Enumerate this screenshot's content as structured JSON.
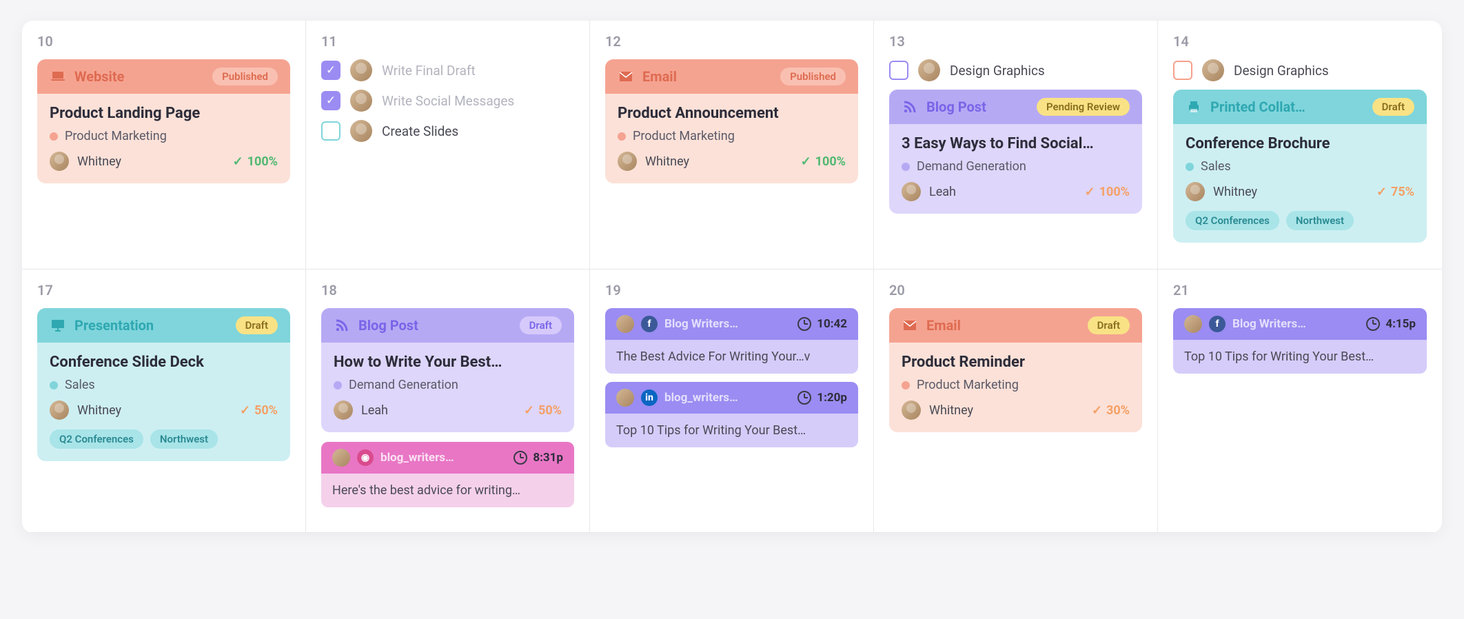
{
  "days": [
    {
      "number": "10",
      "tasks": [],
      "cards": [
        {
          "kind": "full",
          "theme": "theme-orange",
          "icon": "laptop",
          "type_label": "Website",
          "status": "Published",
          "status_class": "",
          "title": "Product Landing Page",
          "category": "Product Marketing",
          "dot_color": "#f5a391",
          "assignee": "Whitney",
          "progress": "100%",
          "progress_check": "green",
          "tags": []
        }
      ]
    },
    {
      "number": "11",
      "tasks": [
        {
          "checked": true,
          "cb": "checked",
          "label": "Write Final Draft",
          "done": true
        },
        {
          "checked": true,
          "cb": "checked",
          "label": "Write Social Messages",
          "done": true
        },
        {
          "checked": false,
          "cb": "unchecked-teal",
          "label": "Create Slides",
          "done": false
        }
      ],
      "cards": []
    },
    {
      "number": "12",
      "tasks": [],
      "cards": [
        {
          "kind": "full",
          "theme": "theme-orange",
          "icon": "envelope",
          "type_label": "Email",
          "status": "Published",
          "status_class": "",
          "title": "Product Announcement",
          "category": "Product Marketing",
          "dot_color": "#f5a391",
          "assignee": "Whitney",
          "progress": "100%",
          "progress_check": "green",
          "tags": []
        }
      ]
    },
    {
      "number": "13",
      "tasks": [
        {
          "checked": false,
          "cb": "unchecked",
          "label": "Design Graphics",
          "done": false
        }
      ],
      "cards": [
        {
          "kind": "full",
          "theme": "theme-purple",
          "icon": "rss",
          "type_label": "Blog Post",
          "status": "Pending Review",
          "status_class": "",
          "title": "3 Easy Ways to Find Social…",
          "category": "Demand Generation",
          "dot_color": "#b6a9f4",
          "assignee": "Leah",
          "progress": "100%",
          "progress_check": "orange",
          "tags": []
        }
      ]
    },
    {
      "number": "14",
      "tasks": [
        {
          "checked": false,
          "cb": "unchecked-orange",
          "label": "Design Graphics",
          "done": false
        }
      ],
      "cards": [
        {
          "kind": "full",
          "theme": "theme-cyan",
          "icon": "printer",
          "type_label": "Printed Collat…",
          "status": "Draft",
          "status_class": "",
          "title": "Conference Brochure",
          "category": "Sales",
          "dot_color": "#7fd5db",
          "assignee": "Whitney",
          "progress": "75%",
          "progress_check": "orange",
          "tags": [
            {
              "text": "Q2 Conferences",
              "class": "tag-cyan"
            },
            {
              "text": "Northwest",
              "class": "tag-cyan"
            }
          ]
        }
      ]
    },
    {
      "number": "17",
      "tasks": [],
      "cards": [
        {
          "kind": "full",
          "theme": "theme-cyan",
          "icon": "presentation",
          "type_label": "Presentation",
          "status": "Draft",
          "status_class": "",
          "title": "Conference Slide Deck",
          "category": "Sales",
          "dot_color": "#7fd5db",
          "assignee": "Whitney",
          "progress": "50%",
          "progress_check": "orange",
          "tags": [
            {
              "text": "Q2 Conferences",
              "class": "tag-cyan"
            },
            {
              "text": "Northwest",
              "class": "tag-cyan"
            }
          ]
        }
      ]
    },
    {
      "number": "18",
      "tasks": [],
      "cards": [
        {
          "kind": "full",
          "theme": "theme-purple",
          "icon": "rss",
          "type_label": "Blog Post",
          "status": "Draft",
          "status_class": "draft",
          "title": "How to Write Your Best…",
          "category": "Demand Generation",
          "dot_color": "#b6a9f4",
          "assignee": "Leah",
          "progress": "50%",
          "progress_check": "orange",
          "tags": []
        },
        {
          "kind": "social",
          "variant": "social-pink",
          "badge": "ig",
          "handle": "blog_writers…",
          "time": "8:31p",
          "body": "Here's the best advice for writing…"
        }
      ]
    },
    {
      "number": "19",
      "tasks": [],
      "cards": [
        {
          "kind": "social",
          "variant": "social-purple",
          "badge": "fb",
          "handle": "Blog Writers…",
          "time": "10:42",
          "body": "The Best Advice For Writing Your…v"
        },
        {
          "kind": "social",
          "variant": "social-purple",
          "badge": "li",
          "handle": "blog_writers…",
          "time": "1:20p",
          "body": "Top 10 Tips for Writing Your Best…"
        }
      ]
    },
    {
      "number": "20",
      "tasks": [],
      "cards": [
        {
          "kind": "full",
          "theme": "theme-orange-draft",
          "icon": "envelope",
          "type_label": "Email",
          "status": "Draft",
          "status_class": "",
          "title": "Product Reminder",
          "category": "Product Marketing",
          "dot_color": "#f5a391",
          "assignee": "Whitney",
          "progress": "30%",
          "progress_check": "orange",
          "tags": []
        }
      ]
    },
    {
      "number": "21",
      "tasks": [],
      "cards": [
        {
          "kind": "social",
          "variant": "social-purple",
          "badge": "fb",
          "handle": "Blog Writers…",
          "time": "4:15p",
          "body": "Top 10 Tips for Writing Your Best…"
        }
      ]
    }
  ]
}
